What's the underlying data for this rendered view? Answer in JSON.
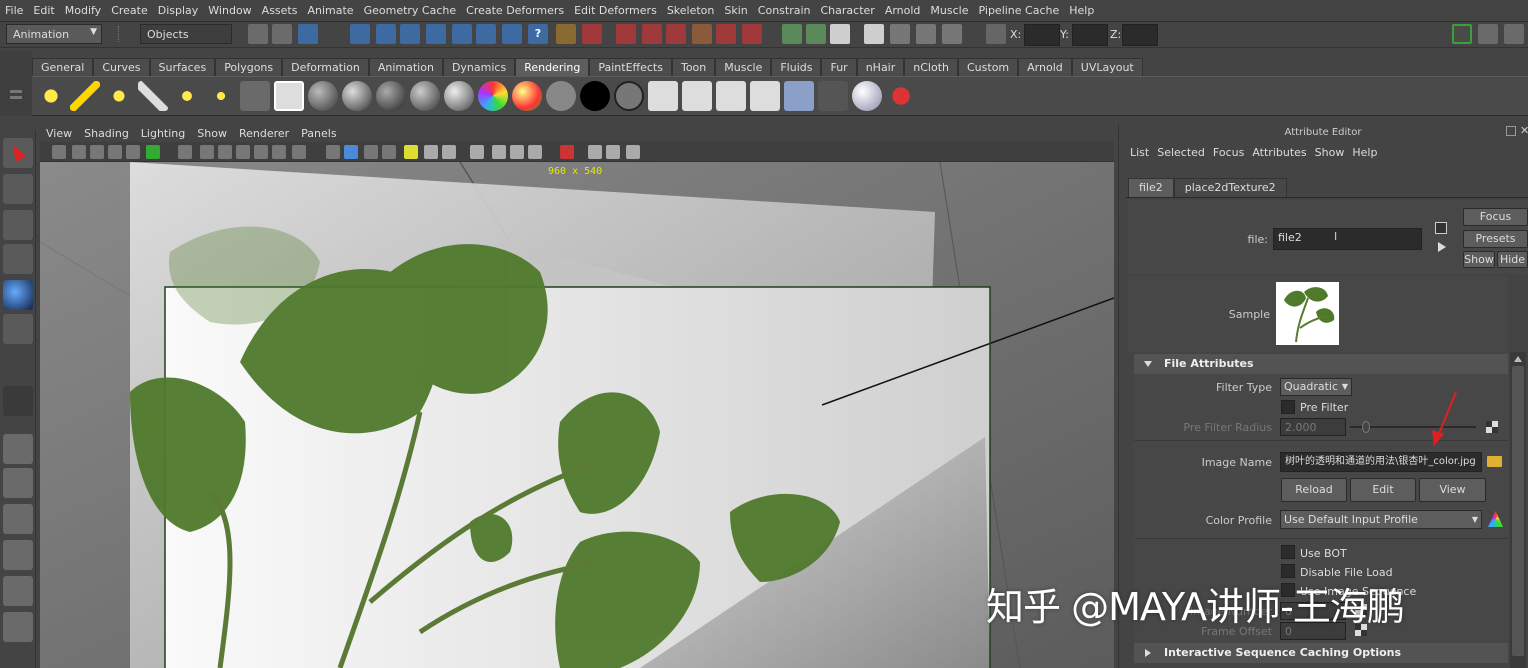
{
  "menubar": {
    "items": [
      "File",
      "Edit",
      "Modify",
      "Create",
      "Display",
      "Window",
      "Assets",
      "Animate",
      "Geometry Cache",
      "Create Deformers",
      "Edit Deformers",
      "Skeleton",
      "Skin",
      "Constrain",
      "Character",
      "Arnold",
      "Muscle",
      "Pipeline Cache",
      "Help"
    ]
  },
  "status": {
    "mode": "Animation",
    "selection_mode": "Objects",
    "x_label": "X:",
    "y_label": "Y:",
    "z_label": "Z:"
  },
  "shelf": {
    "tabs": [
      "General",
      "Curves",
      "Surfaces",
      "Polygons",
      "Deformation",
      "Animation",
      "Dynamics",
      "Rendering",
      "PaintEffects",
      "Toon",
      "Muscle",
      "Fluids",
      "Fur",
      "nHair",
      "nCloth",
      "Custom",
      "Arnold",
      "UVLayout"
    ],
    "active_tab": "Rendering"
  },
  "viewport": {
    "menu": [
      "View",
      "Shading",
      "Lighting",
      "Show",
      "Renderer",
      "Panels"
    ],
    "resolution": "960 x 540"
  },
  "attribute_editor": {
    "title": "Attribute Editor",
    "menu": [
      "List",
      "Selected",
      "Focus",
      "Attributes",
      "Show",
      "Help"
    ],
    "tabs": [
      "file2",
      "place2dTexture2"
    ],
    "active_tab": "file2",
    "node_label": "file:",
    "node_name": "file2",
    "focus_btn": "Focus",
    "presets_btn": "Presets",
    "show_btn": "Show",
    "hide_btn": "Hide",
    "sample_label": "Sample",
    "section_file_attributes": "File Attributes",
    "filter_type_label": "Filter Type",
    "filter_type_value": "Quadratic",
    "pre_filter_label": "Pre Filter",
    "pre_filter_radius_label": "Pre Filter Radius",
    "pre_filter_radius_value": "2.000",
    "image_name_label": "Image Name",
    "image_name_value": "树叶的透明和通道的用法\\银杏叶_color.jpg",
    "reload_btn": "Reload",
    "edit_btn": "Edit",
    "view_btn": "View",
    "color_profile_label": "Color Profile",
    "color_profile_value": "Use Default Input Profile",
    "use_bot_label": "Use BOT",
    "disable_file_load_label": "Disable File Load",
    "use_image_sequence_label": "Use Image Sequence",
    "image_number_label": "Image Number",
    "image_number_value": "0",
    "frame_offset_label": "Frame Offset",
    "frame_offset_value": "0",
    "section_caching": "Interactive Sequence Caching Options"
  },
  "watermark": "知乎 @MAYA讲师-王海鹏",
  "colors": {
    "accent_tab": "#5d5d5d",
    "leaf_green": "#4f7a2c",
    "arrow_red": "#e02020",
    "resolution_text": "#e8e800"
  }
}
